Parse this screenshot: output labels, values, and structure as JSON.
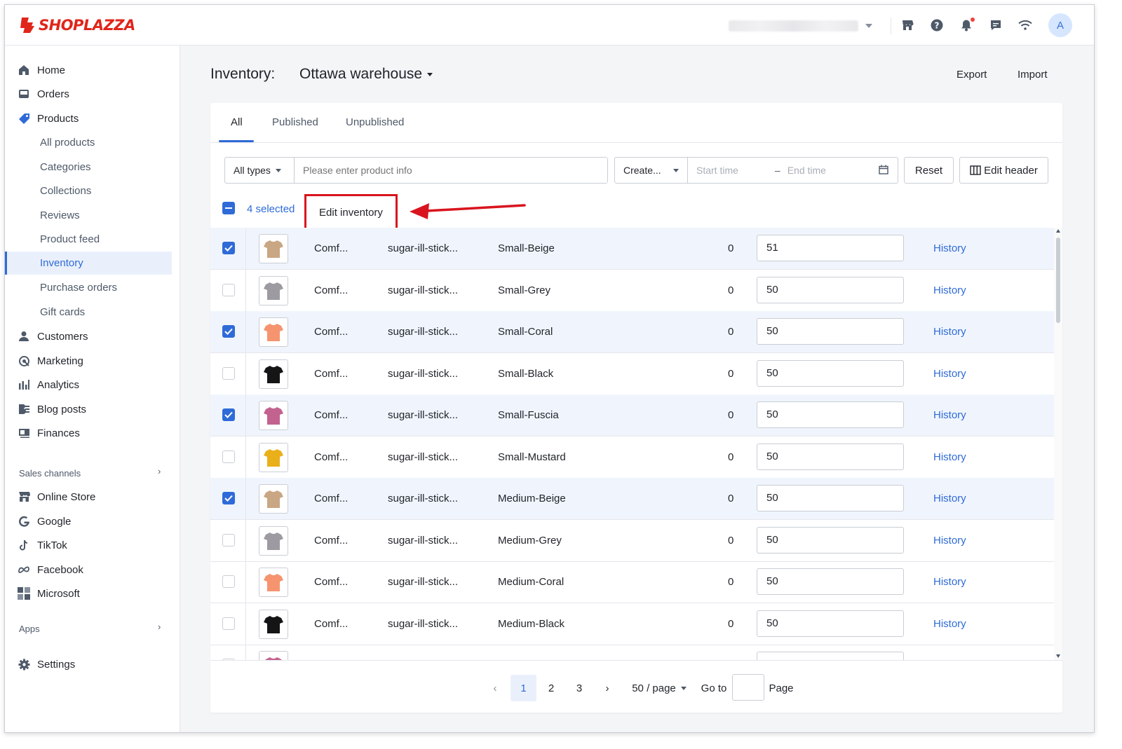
{
  "app": {
    "brand": "SHOPLAZZA",
    "avatar_letter": "A"
  },
  "sidebar": {
    "main_items": [
      {
        "label": "Home",
        "icon": "home-icon"
      },
      {
        "label": "Orders",
        "icon": "orders-icon"
      },
      {
        "label": "Products",
        "icon": "tag-icon"
      }
    ],
    "product_sub_items": [
      {
        "label": "All products"
      },
      {
        "label": "Categories"
      },
      {
        "label": "Collections"
      },
      {
        "label": "Reviews"
      },
      {
        "label": "Product feed"
      },
      {
        "label": "Inventory",
        "active": true
      },
      {
        "label": "Purchase orders"
      },
      {
        "label": "Gift cards"
      }
    ],
    "lower_items": [
      {
        "label": "Customers",
        "icon": "customer-icon"
      },
      {
        "label": "Marketing",
        "icon": "marketing-icon"
      },
      {
        "label": "Analytics",
        "icon": "analytics-icon"
      },
      {
        "label": "Blog posts",
        "icon": "blog-icon"
      },
      {
        "label": "Finances",
        "icon": "finances-icon"
      }
    ],
    "sales_channels_label": "Sales channels",
    "channels": [
      {
        "label": "Online Store",
        "icon": "store-icon"
      },
      {
        "label": "Google",
        "icon": "google-icon"
      },
      {
        "label": "TikTok",
        "icon": "tiktok-icon"
      },
      {
        "label": "Facebook",
        "icon": "meta-icon"
      },
      {
        "label": "Microsoft",
        "icon": "microsoft-icon"
      }
    ],
    "apps_label": "Apps",
    "settings_label": "Settings"
  },
  "header": {
    "title": "Inventory:",
    "warehouse": "Ottawa warehouse",
    "export_label": "Export",
    "import_label": "Import"
  },
  "tabs": [
    {
      "label": "All",
      "active": true
    },
    {
      "label": "Published"
    },
    {
      "label": "Unpublished"
    }
  ],
  "filters": {
    "type_select": "All types",
    "search_placeholder": "Please enter product info",
    "date_type_select": "Create...",
    "start_placeholder": "Start time",
    "range_separator": "–",
    "end_placeholder": "End time",
    "reset_label": "Reset",
    "edit_header_label": "Edit header"
  },
  "bulk": {
    "selected_label": "4 selected",
    "edit_inventory_label": "Edit inventory"
  },
  "rows": [
    {
      "checked": true,
      "color": "#c9a684",
      "product": "Comf...",
      "sku": "sugar-ill-stick...",
      "variant": "Small-Beige",
      "committed": "0",
      "available": "51"
    },
    {
      "checked": false,
      "color": "#9d9aa1",
      "product": "Comf...",
      "sku": "sugar-ill-stick...",
      "variant": "Small-Grey",
      "committed": "0",
      "available": "50"
    },
    {
      "checked": true,
      "color": "#f5946f",
      "product": "Comf...",
      "sku": "sugar-ill-stick...",
      "variant": "Small-Coral",
      "committed": "0",
      "available": "50"
    },
    {
      "checked": false,
      "color": "#151515",
      "product": "Comf...",
      "sku": "sugar-ill-stick...",
      "variant": "Small-Black",
      "committed": "0",
      "available": "50"
    },
    {
      "checked": true,
      "color": "#c2628f",
      "product": "Comf...",
      "sku": "sugar-ill-stick...",
      "variant": "Small-Fuscia",
      "committed": "0",
      "available": "50"
    },
    {
      "checked": false,
      "color": "#eab01a",
      "product": "Comf...",
      "sku": "sugar-ill-stick...",
      "variant": "Small-Mustard",
      "committed": "0",
      "available": "50"
    },
    {
      "checked": true,
      "color": "#c9a684",
      "product": "Comf...",
      "sku": "sugar-ill-stick...",
      "variant": "Medium-Beige",
      "committed": "0",
      "available": "50"
    },
    {
      "checked": false,
      "color": "#9d9aa1",
      "product": "Comf...",
      "sku": "sugar-ill-stick...",
      "variant": "Medium-Grey",
      "committed": "0",
      "available": "50"
    },
    {
      "checked": false,
      "color": "#f5946f",
      "product": "Comf...",
      "sku": "sugar-ill-stick...",
      "variant": "Medium-Coral",
      "committed": "0",
      "available": "50"
    },
    {
      "checked": false,
      "color": "#151515",
      "product": "Comf...",
      "sku": "sugar-ill-stick...",
      "variant": "Medium-Black",
      "committed": "0",
      "available": "50"
    },
    {
      "checked": false,
      "color": "#c2628f",
      "product": "",
      "sku": "",
      "variant": "",
      "committed": "",
      "available": ""
    }
  ],
  "history_label": "History",
  "pagination": {
    "pages": [
      "1",
      "2",
      "3"
    ],
    "current": "1",
    "page_size": "50 / page",
    "goto_label": "Go to",
    "page_label": "Page"
  },
  "colors": {
    "accent": "#2f6bd8",
    "highlight_box": "#d9141e",
    "brand": "#e0261b"
  }
}
